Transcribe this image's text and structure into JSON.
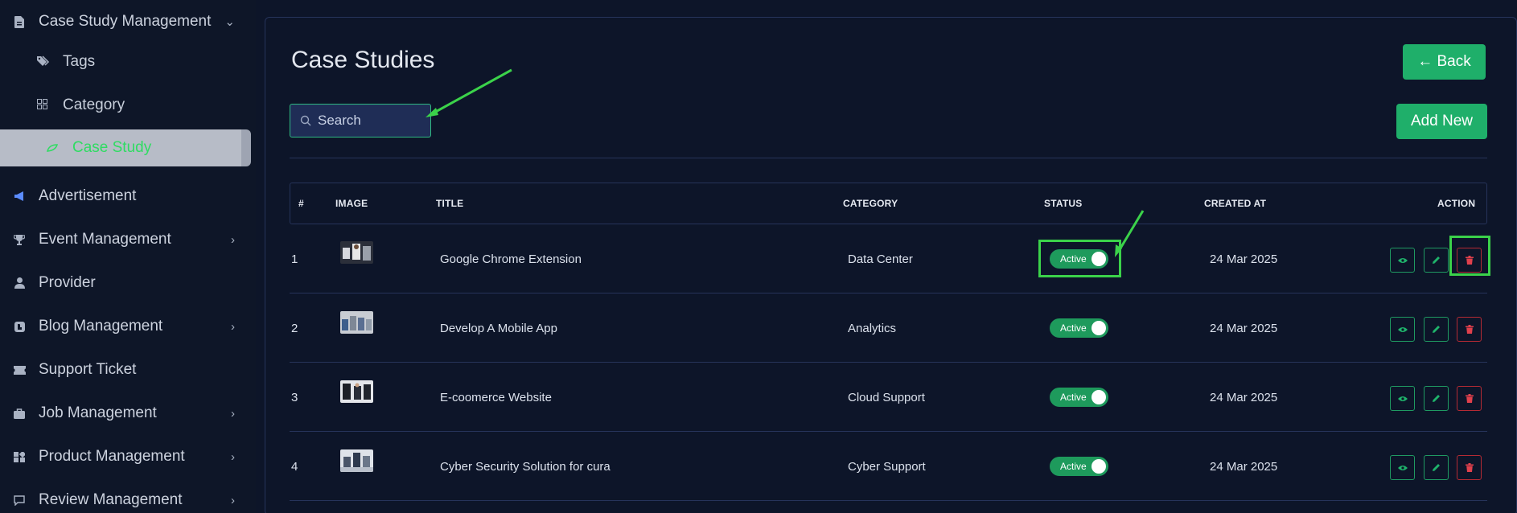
{
  "sidebar": {
    "case_study_management": "Case Study Management",
    "tags": "Tags",
    "category": "Category",
    "case_study": "Case Study",
    "advertisement": "Advertisement",
    "event_management": "Event Management",
    "provider": "Provider",
    "blog_management": "Blog Management",
    "support_ticket": "Support Ticket",
    "job_management": "Job Management",
    "product_management": "Product Management",
    "review_management": "Review Management"
  },
  "header": {
    "title": "Case Studies",
    "back_label": "← Back",
    "add_label": "Add New"
  },
  "search": {
    "placeholder": "Search"
  },
  "table": {
    "columns": [
      "#",
      "IMAGE",
      "TITLE",
      "CATEGORY",
      "STATUS",
      "CREATED AT",
      "ACTION"
    ],
    "rows": [
      {
        "num": "1",
        "title": "Google Chrome Extension",
        "category": "Data Center",
        "status": "Active",
        "created": "24 Mar 2025"
      },
      {
        "num": "2",
        "title": "Develop A Mobile App",
        "category": "Analytics",
        "status": "Active",
        "created": "24 Mar 2025"
      },
      {
        "num": "3",
        "title": "E-coomerce Website",
        "category": "Cloud Support",
        "status": "Active",
        "created": "24 Mar 2025"
      },
      {
        "num": "4",
        "title": "Cyber Security Solution for cura",
        "category": "Cyber Support",
        "status": "Active",
        "created": "24 Mar 2025"
      }
    ]
  },
  "colors": {
    "accent": "#1faf6a",
    "danger": "#d23a45",
    "annotation": "#3bd24a",
    "background": "#0d1529"
  }
}
